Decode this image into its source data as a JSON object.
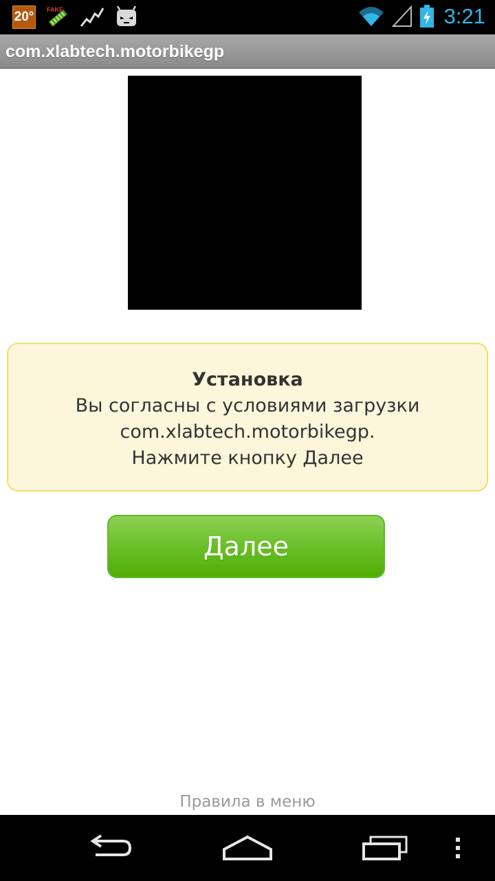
{
  "status_bar": {
    "temperature": "20°",
    "clock": "3:21",
    "icons": [
      "fake-gps-icon",
      "stocks-chart-icon",
      "android-robot-icon",
      "wifi-icon",
      "signal-icon",
      "battery-charging-icon"
    ]
  },
  "title_bar": {
    "title": "com.xlabtech.motorbikegp"
  },
  "info_box": {
    "heading": "Установка",
    "line1": "Вы согласны с условиями загрузки",
    "line2": "com.xlabtech.motorbikegp.",
    "line3": "Нажмите кнопку Далее",
    "background_color": "#fcf6da",
    "border_color": "#f3df68"
  },
  "next_button": {
    "label": "Далее",
    "color": "#5cb512"
  },
  "footer": {
    "rules_link": "Правила в меню"
  },
  "nav_bar": {
    "icons": [
      "back-icon",
      "home-icon",
      "recent-apps-icon",
      "menu-icon"
    ]
  },
  "colors": {
    "accent_clock": "#33b5e5"
  }
}
